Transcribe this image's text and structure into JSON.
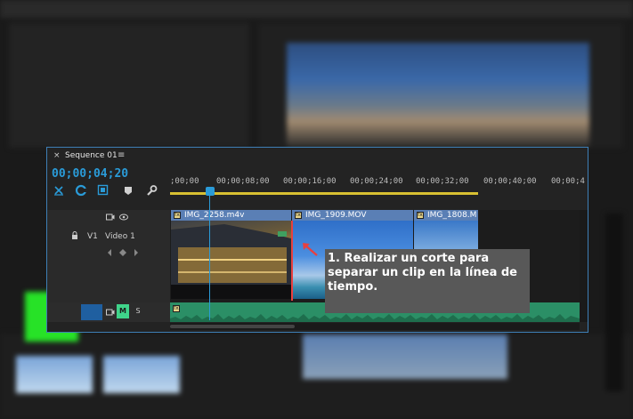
{
  "sequence": {
    "tab_close": "×",
    "tab_title": "Sequence 01",
    "tab_menu": "≡",
    "timecode": "00;00;04;20"
  },
  "ruler": {
    "labels": [
      ";00;00",
      "00;00;08;00",
      "00;00;16;00",
      "00;00;24;00",
      "00;00;32;00",
      "00;00;40;00",
      "00;00;4"
    ]
  },
  "tracks": {
    "video": {
      "target": "V1",
      "name": "Video 1"
    },
    "audio": {
      "mute": "M",
      "solo": "S"
    }
  },
  "clips": [
    {
      "name": "IMG_2258.m4v",
      "color": "#5a7fb5"
    },
    {
      "name": "IMG_1909.MOV",
      "color": "#5a7fb5"
    },
    {
      "name": "IMG_1808.M",
      "color": "#5a7fb5"
    }
  ],
  "tooltip": {
    "text": "1. Realizar un corte para separar un clip en la línea de tiempo."
  },
  "colors": {
    "accent": "#2a9bd8",
    "cut": "#e84040",
    "audio": "#2b8f66",
    "mute": "#3fd48a"
  },
  "icons": [
    "snap-icon",
    "linked-selection-icon",
    "add-marker-icon",
    "marker-icon",
    "wrench-icon",
    "camera-icon",
    "eye-icon",
    "lock-icon",
    "keyframe-nav-icon"
  ]
}
